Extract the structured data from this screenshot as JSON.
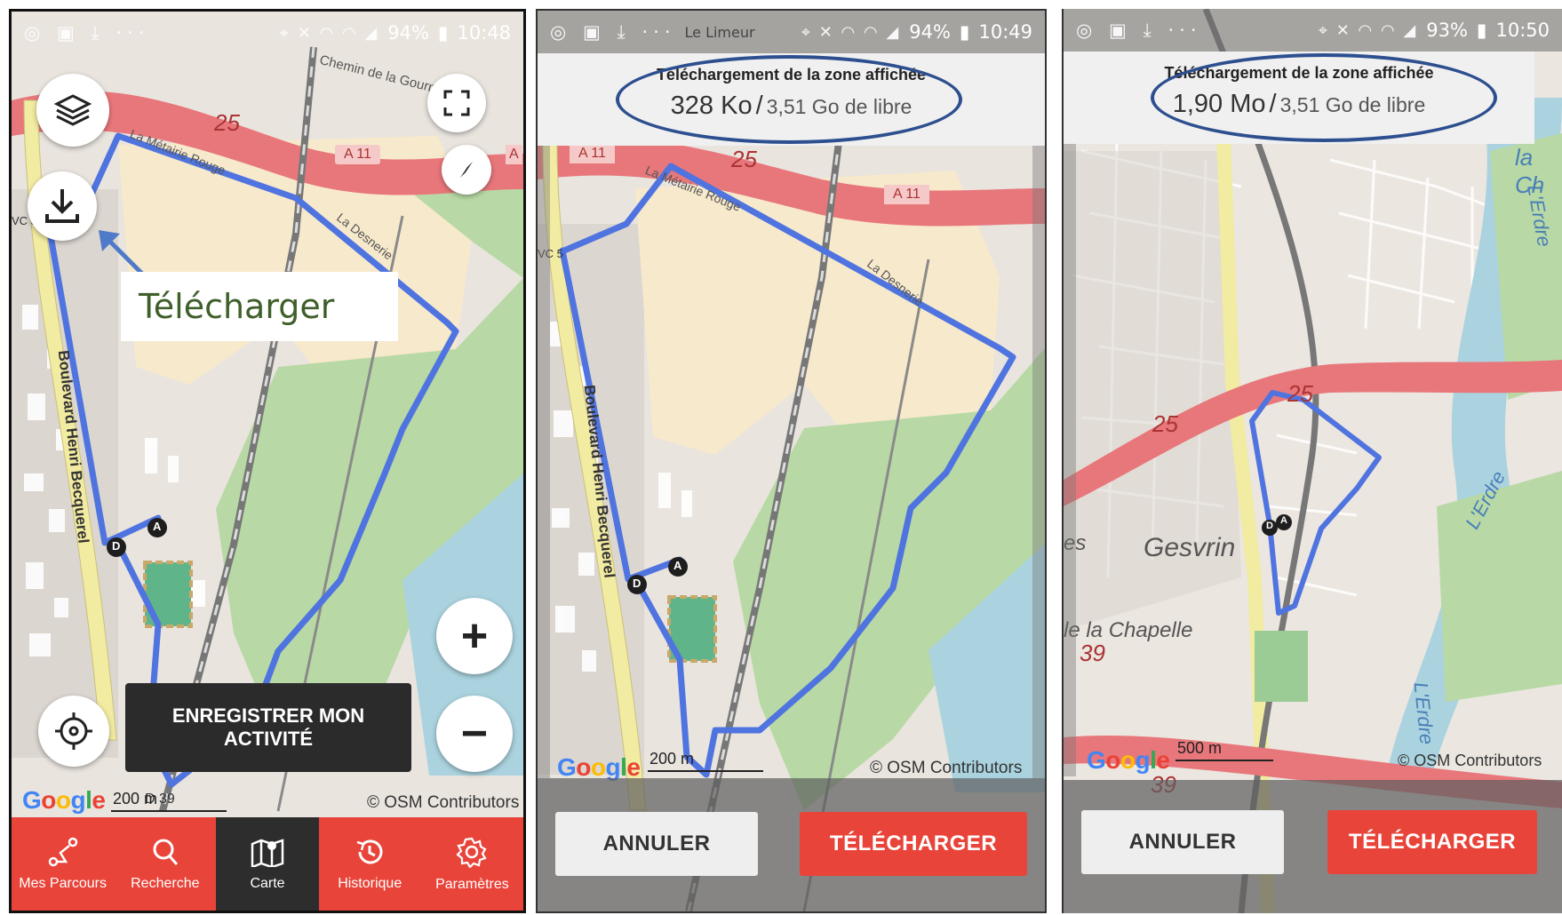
{
  "colors": {
    "accent": "#e8443a",
    "route": "#4f74e0",
    "motorway": "#e8777b",
    "annotation": "#2d4f8f",
    "callout_text": "#3f5f2a"
  },
  "phones": [
    {
      "status": {
        "battery": "94%",
        "time": "10:48"
      },
      "map": {
        "road_number": "25",
        "road_a11": "A 11",
        "road_a11b": "A",
        "road_d39": "D 39",
        "street_top": "Chemin de la Gourn",
        "street_main": "Boulevard Henri Becquerel",
        "street_a": "La Métairie Rouge",
        "street_b": "La Desnerie",
        "badge_vc": "VC 5",
        "marker_d": "D",
        "marker_a": "A"
      },
      "callout": "Télécharger",
      "record_button": "ENREGISTRER MON ACTIVITÉ",
      "google_logo": "Google",
      "scale": "200 m",
      "attribution": "© OSM Contributors",
      "icons": [
        "layers-icon",
        "download-icon",
        "fullscreen-icon",
        "compass-icon",
        "locate-icon",
        "zoom-in-icon",
        "zoom-out-icon"
      ],
      "nav": [
        {
          "label": "Mes Parcours",
          "icon": "route-icon"
        },
        {
          "label": "Recherche",
          "icon": "search-icon"
        },
        {
          "label": "Carte",
          "icon": "map-icon"
        },
        {
          "label": "Historique",
          "icon": "history-icon"
        },
        {
          "label": "Paramètres",
          "icon": "gear-icon"
        }
      ],
      "zoom_in_symbol": "+",
      "zoom_out_symbol": "−"
    },
    {
      "status": {
        "battery": "94%",
        "time": "10:49",
        "place": "Le Limeur"
      },
      "download_title": "Téléchargement de la zone affichée",
      "size": "328 Ko",
      "separator": "/",
      "free": "3,51 Go de libre",
      "map": {
        "road_number": "25",
        "road_a11": "A 11",
        "road_a11b": "A 11",
        "street_main": "Boulevard Henri Becquerel",
        "street_a": "La Métairie Rouge",
        "street_b": "La Desnerie",
        "badge_vc": "VC 5",
        "marker_d": "D",
        "marker_a": "A"
      },
      "google_logo": "Google",
      "scale": "200 m",
      "attribution": "© OSM Contributors",
      "cancel_label": "ANNULER",
      "download_label": "TÉLÉCHARGER"
    },
    {
      "status": {
        "battery": "93%",
        "time": "10:50"
      },
      "download_title": "Téléchargement de la zone affichée",
      "size": "1,90 Mo",
      "separator": "/",
      "free": "3,51 Go de libre",
      "map": {
        "road_25a": "25",
        "road_25b": "25",
        "road_39a": "39",
        "road_39b": "39",
        "place_gesvres": "Gesvrin",
        "place_chapelle": "le la Chapelle",
        "river_a": "L'Erdre",
        "river_b": "L'Erdre",
        "river_c": "L'Erdre",
        "top_right": "la Ch",
        "left_edge": "es",
        "marker_d": "D",
        "marker_a": "A"
      },
      "google_logo": "Google",
      "scale": "500 m",
      "attribution": "© OSM Contributors",
      "cancel_label": "ANNULER",
      "download_label": "TÉLÉCHARGER"
    }
  ]
}
